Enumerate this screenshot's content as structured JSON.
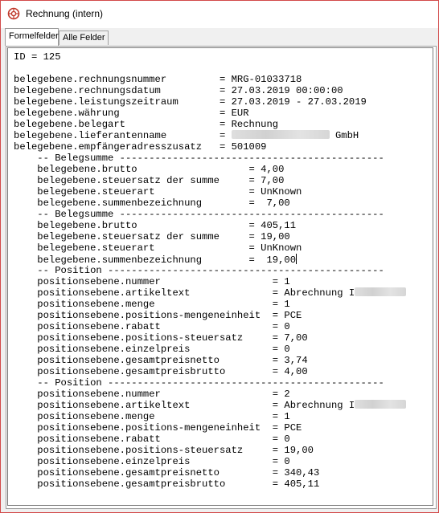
{
  "window": {
    "title": "Rechnung (intern)",
    "accent": "#d24a4a"
  },
  "tabs": [
    {
      "label": "Formelfelder",
      "active": true
    },
    {
      "label": "Alle Felder",
      "active": false
    }
  ],
  "content": {
    "lines": [
      "ID = 125",
      "",
      "belegebene.rechnungsnummer         = MRG-01033718",
      "belegebene.rechnungsdatum          = 27.03.2019 00:00:00",
      "belegebene.leistungszeitraum       = 27.03.2019 - 27.03.2019",
      "belegebene.währung                 = EUR",
      "belegebene.belegart                = Rechnung",
      "belegebene.lieferantenname         = ",
      "belegebene.empfängeradresszusatz   = 501009",
      "    -- Belegsumme ---------------------------------------------",
      "    belegebene.brutto                   = 4,00",
      "    belegebene.steuersatz der summe     = 7,00",
      "    belegebene.steuerart                = UnKnown",
      "    belegebene.summenbezeichnung        =  7,00",
      "    -- Belegsumme ---------------------------------------------",
      "    belegebene.brutto                   = 405,11",
      "    belegebene.steuersatz der summe     = 19,00",
      "    belegebene.steuerart                = UnKnown",
      "    belegebene.summenbezeichnung        =  19,00",
      "    -- Position -----------------------------------------------",
      "    positionsebene.nummer                   = 1",
      "    positionsebene.artikeltext              = Abrechnung I",
      "    positionsebene.menge                    = 1",
      "    positionsebene.positions-mengeneinheit  = PCE",
      "    positionsebene.rabatt                   = 0",
      "    positionsebene.positions-steuersatz     = 7,00",
      "    positionsebene.einzelpreis              = 0",
      "    positionsebene.gesamtpreisnetto         = 3,74",
      "    positionsebene.gesamtpreisbrutto        = 4,00",
      "    -- Position -----------------------------------------------",
      "    positionsebene.nummer                   = 2",
      "    positionsebene.artikeltext              = Abrechnung I",
      "    positionsebene.menge                    = 1",
      "    positionsebene.positions-mengeneinheit  = PCE",
      "    positionsebene.rabatt                   = 0",
      "    positionsebene.positions-steuersatz     = 19,00",
      "    positionsebene.einzelpreis              = 0",
      "    positionsebene.gesamtpreisnetto         = 340,43",
      "    positionsebene.gesamtpreisbrutto        = 405,11"
    ],
    "lieferant_suffix": "GmbH"
  }
}
